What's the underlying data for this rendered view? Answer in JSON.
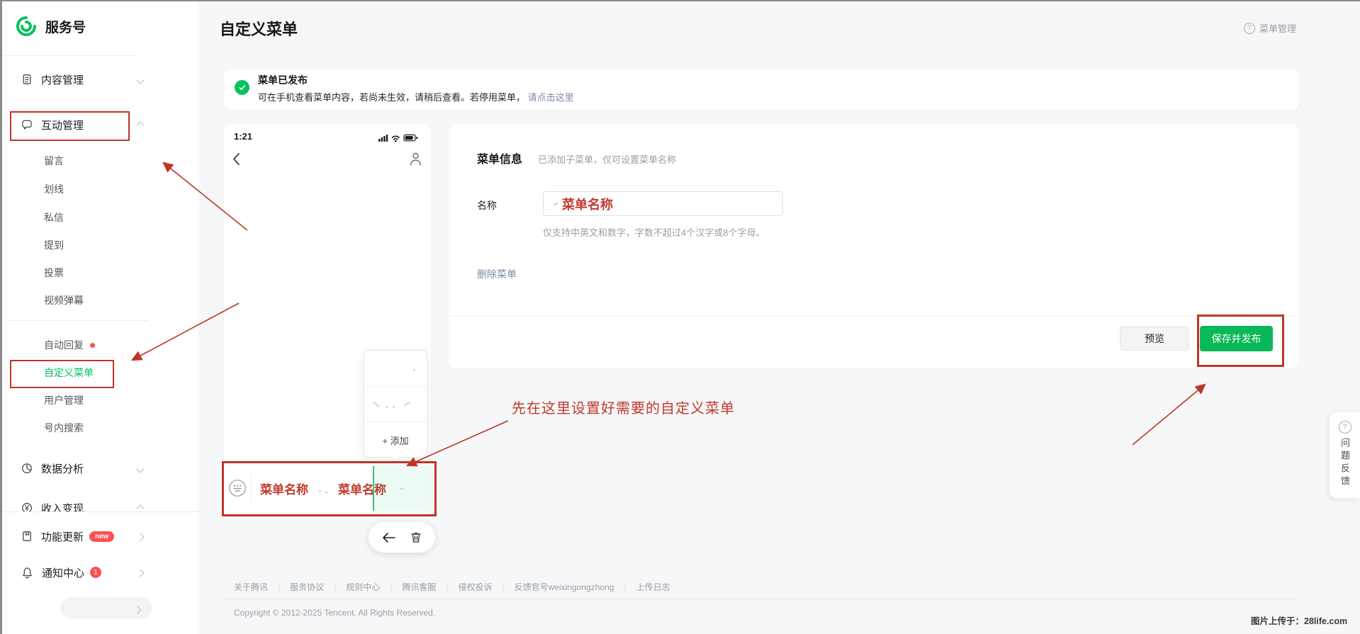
{
  "app": {
    "logo_text": "服务号"
  },
  "header": {
    "title": "自定义菜单",
    "help": "菜单管理"
  },
  "sidebar": {
    "items": {
      "content": "内容管理",
      "interact": "互动管理",
      "data": "数据分析",
      "income": "收入变现",
      "update": "功能更新",
      "notify": "通知中心"
    },
    "sub": [
      "留言",
      "划线",
      "私信",
      "提到",
      "投票",
      "视频弹幕"
    ],
    "tools": [
      "自动回复",
      "自定义菜单",
      "用户管理",
      "号内搜索"
    ],
    "badges": {
      "update": "new",
      "notify": "1"
    }
  },
  "notice": {
    "title": "菜单已发布",
    "body": "可在手机查看菜单内容，若尚未生效，请稍后查看。若停用菜单，",
    "link": "请点击这里"
  },
  "phone": {
    "time": "1:21",
    "menu_items": [
      "菜单名称",
      "菜单名称"
    ],
    "popup_add": "+ 添加"
  },
  "form": {
    "section_title": "菜单信息",
    "section_note": "已添加子菜单，仅可设置菜单名称",
    "name_label": "名称",
    "name_value": "菜单名称",
    "name_help": "仅支持中英文和数字，字数不超过4个汉字或8个字母。",
    "delete_link": "删除菜单",
    "preview_button": "预览",
    "save_button": "保存并发布"
  },
  "annotation": {
    "tip": "先在这里设置好需要的自定义菜单"
  },
  "footer": {
    "links": [
      "关于腾讯",
      "服务协议",
      "规则中心",
      "腾讯客服",
      "侵权投诉",
      "反馈官号weixingongzhong",
      "上传日志"
    ],
    "copyright": "Copyright © 2012-2025 Tencent. All Rights Reserved."
  },
  "feedback": {
    "label": "问题反馈"
  },
  "watermark": {
    "text": "图片上传于：28life.com"
  },
  "colors": {
    "accent": "#07C160",
    "annotation_red": "#C03527",
    "badge_red": "#FA5151",
    "link_blue": "#7D8BA4"
  }
}
